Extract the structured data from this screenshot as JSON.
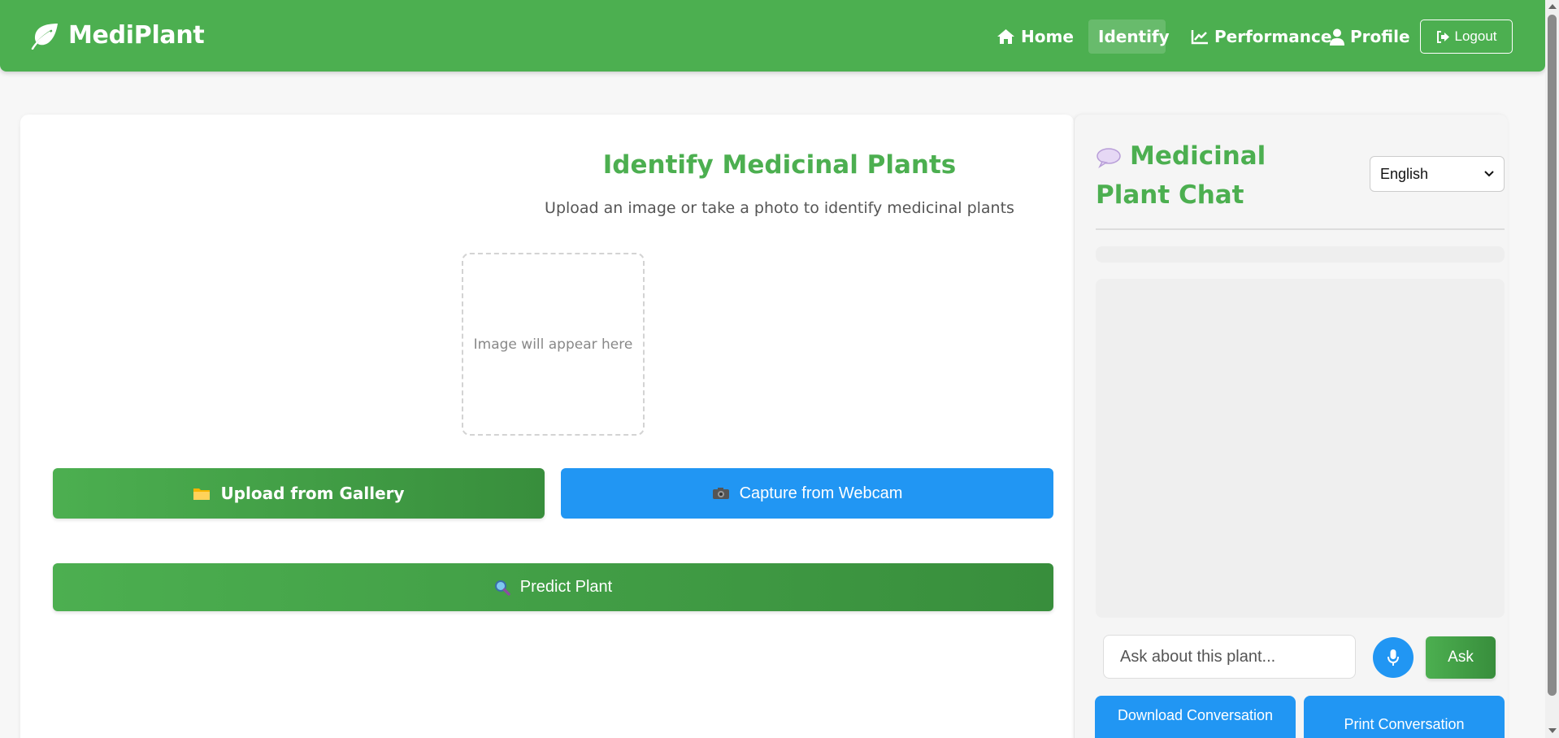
{
  "nav": {
    "brand": "MediPlant",
    "links": [
      {
        "label": "Home",
        "icon": "home-icon"
      },
      {
        "label": "Identify",
        "icon": "search-icon"
      },
      {
        "label": "Performance",
        "icon": "chart-line-icon"
      },
      {
        "label": "Profile",
        "icon": "user-icon"
      }
    ],
    "logout": "Logout",
    "active": "Identify"
  },
  "main": {
    "title": "Identify Medicinal Plants",
    "subtitle": "Upload an image or take a photo to identify medicinal plants",
    "image_placeholder": "Image will appear here",
    "upload_button": "Upload from Gallery",
    "webcam_button": "Capture from Webcam",
    "predict_button": "Predict Plant"
  },
  "chat": {
    "title": "Medicinal Plant Chat",
    "language": "English",
    "input_placeholder": "Ask about this plant...",
    "ask_button": "Ask",
    "download_button": "Download Conversation",
    "print_button": "Print Conversation"
  },
  "colors": {
    "primary": "#4caf50",
    "primary_dark": "#388e3c",
    "accent": "#2196f3",
    "background": "#f7f7f7"
  }
}
